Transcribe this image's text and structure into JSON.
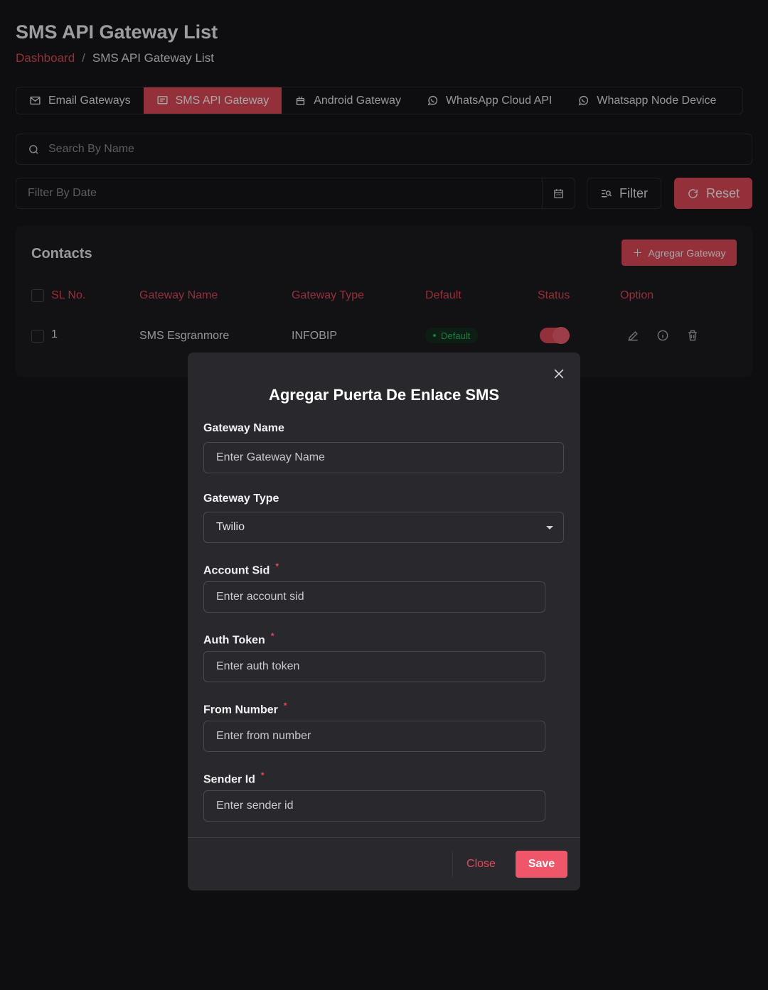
{
  "page": {
    "title": "SMS API Gateway List",
    "breadcrumb": {
      "link": "Dashboard",
      "separator": "/",
      "current": "SMS API Gateway List"
    }
  },
  "tabs": [
    {
      "label": "Email Gateways",
      "icon": "mail-icon"
    },
    {
      "label": "SMS API Gateway",
      "icon": "message-icon",
      "active": true
    },
    {
      "label": "Android Gateway",
      "icon": "android-icon"
    },
    {
      "label": "WhatsApp Cloud API",
      "icon": "whatsapp-icon"
    },
    {
      "label": "Whatsapp Node Device",
      "icon": "whatsapp-icon"
    }
  ],
  "search": {
    "placeholder": "Search By Name"
  },
  "filter_date": {
    "placeholder": "Filter By Date"
  },
  "buttons": {
    "filter": "Filter",
    "reset": "Reset"
  },
  "table": {
    "title": "Contacts",
    "add_button": "Agregar Gateway",
    "columns": [
      "SL No.",
      "Gateway Name",
      "Gateway Type",
      "Default",
      "Status",
      "Option"
    ],
    "rows": [
      {
        "sl": "1",
        "name": "SMS Esgranmore",
        "type": "INFOBIP",
        "default": "Default",
        "status": true
      }
    ]
  },
  "modal": {
    "title": "Agregar Puerta De Enlace SMS",
    "fields": {
      "gateway_name": {
        "label": "Gateway Name",
        "placeholder": "Enter Gateway Name"
      },
      "gateway_type": {
        "label": "Gateway Type",
        "value": "Twilio"
      },
      "account_sid": {
        "label": "Account Sid",
        "placeholder": "Enter account sid",
        "required": "*"
      },
      "auth_token": {
        "label": "Auth Token",
        "placeholder": "Enter auth token",
        "required": "*"
      },
      "from_number": {
        "label": "From Number",
        "placeholder": "Enter from number",
        "required": "*"
      },
      "sender_id": {
        "label": "Sender Id",
        "placeholder": "Enter sender id",
        "required": "*"
      }
    },
    "close": "Close",
    "save": "Save"
  },
  "colors": {
    "accent": "#e44a5a",
    "background": "#161519",
    "modal": "#29282d",
    "success": "#2fbf63"
  }
}
